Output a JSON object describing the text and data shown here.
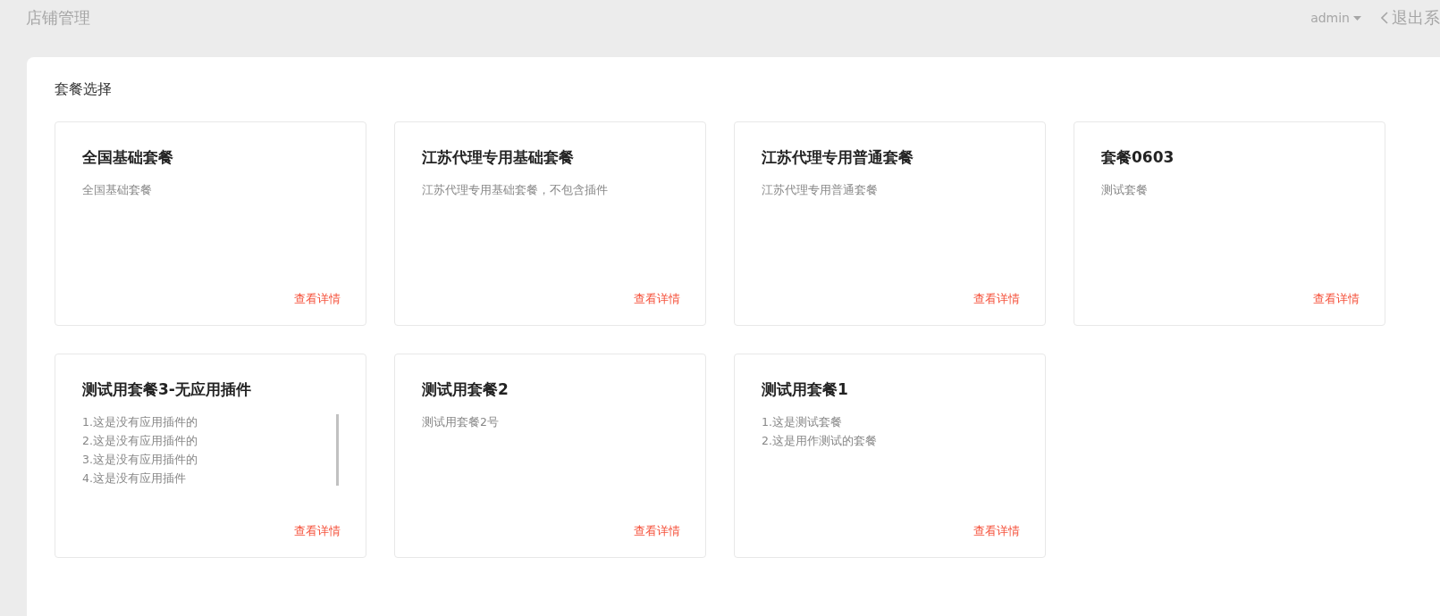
{
  "header": {
    "title": "店铺管理",
    "user": "admin",
    "logout": "退出系"
  },
  "panel": {
    "title": "套餐选择"
  },
  "packages": [
    {
      "name": "全国基础套餐",
      "lines": [
        "全国基础套餐"
      ],
      "link": "查看详情"
    },
    {
      "name": "江苏代理专用基础套餐",
      "lines": [
        "江苏代理专用基础套餐，不包含插件"
      ],
      "link": "查看详情"
    },
    {
      "name": "江苏代理专用普通套餐",
      "lines": [
        "江苏代理专用普通套餐"
      ],
      "link": "查看详情"
    },
    {
      "name": "套餐0603",
      "lines": [
        "测试套餐"
      ],
      "link": "查看详情"
    },
    {
      "name": "测试用套餐3-无应用插件",
      "lines": [
        "1.这是没有应用插件的",
        "2.这是没有应用插件的",
        "3.这是没有应用插件的",
        "4.这是没有应用插件"
      ],
      "link": "查看详情"
    },
    {
      "name": "测试用套餐2",
      "lines": [
        "测试用套餐2号"
      ],
      "link": "查看详情"
    },
    {
      "name": "测试用套餐1",
      "lines": [
        "1.这是测试套餐",
        "2.这是用作测试的套餐"
      ],
      "link": "查看详情"
    }
  ]
}
